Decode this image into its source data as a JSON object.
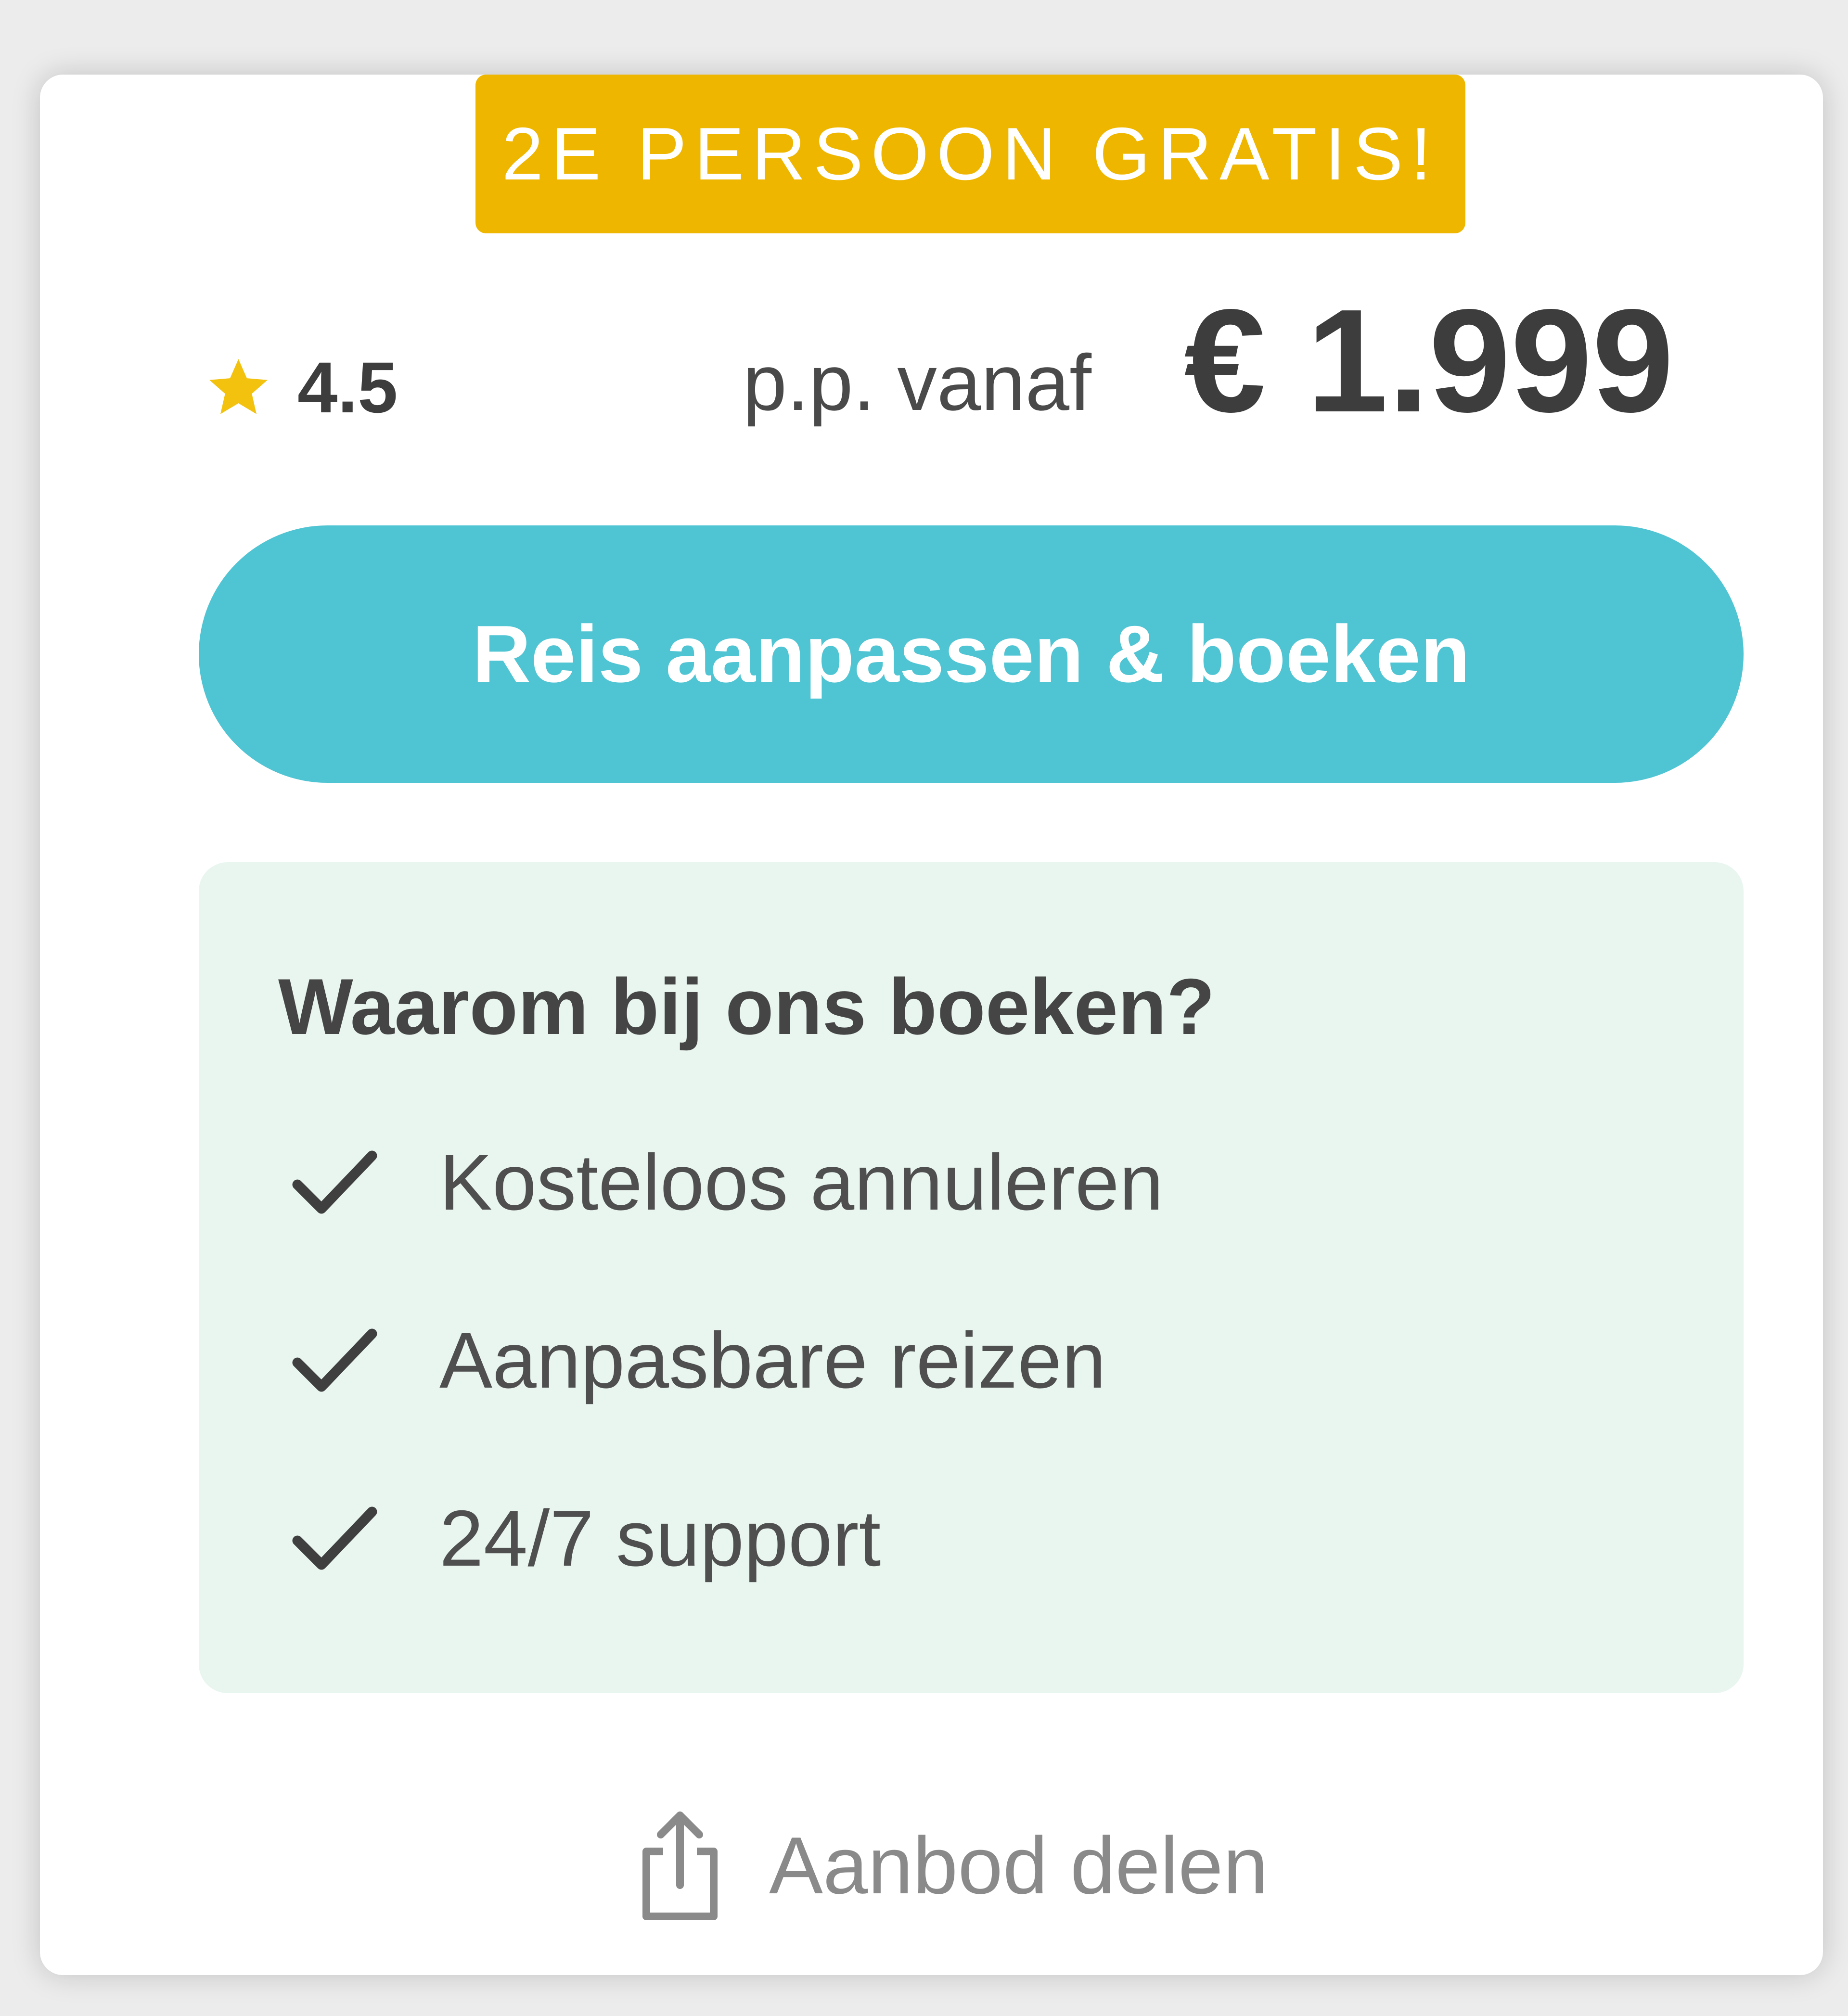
{
  "badge": {
    "text": "2E PERSOON GRATIS!",
    "color": "#efb600"
  },
  "rating": {
    "icon": "star-icon",
    "value": "4.5"
  },
  "price": {
    "label": "p.p. vanaf",
    "value": "€ 1.999"
  },
  "cta": {
    "label": "Reis aanpassen & boeken",
    "color": "#4fc4d3"
  },
  "usp": {
    "title": "Waarom bij ons boeken?",
    "items": [
      {
        "icon": "check-icon",
        "label": "Kosteloos annuleren"
      },
      {
        "icon": "check-icon",
        "label": "Aanpasbare reizen"
      },
      {
        "icon": "check-icon",
        "label": "24/7 support"
      }
    ]
  },
  "share": {
    "icon": "share-icon",
    "label": "Aanbod delen"
  }
}
